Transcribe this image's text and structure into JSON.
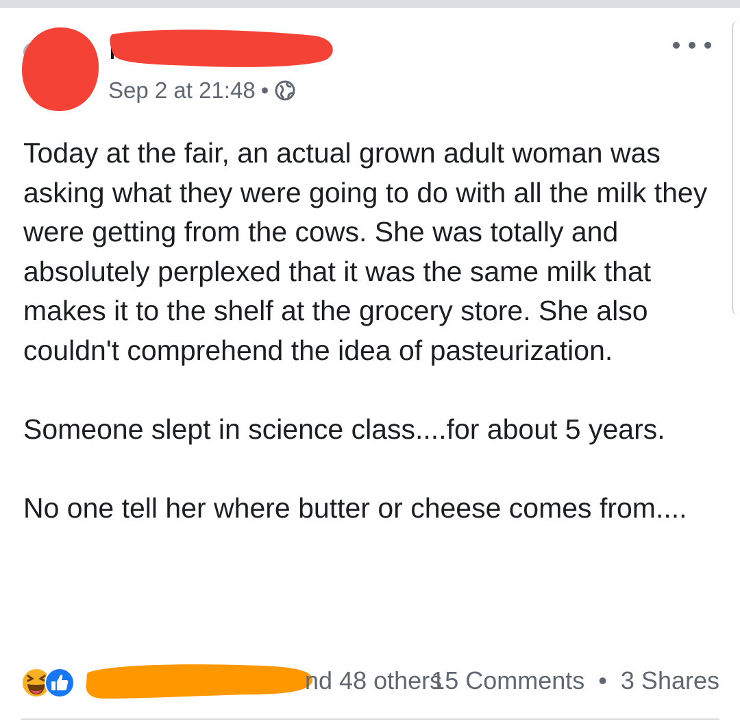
{
  "post": {
    "timestamp": "Sep 2 at 21:48",
    "meta_separator": "•",
    "privacy_icon": "globe-icon",
    "more_icon": "more-horizontal-icon",
    "paragraphs": [
      "Today at the fair, an actual grown adult woman was asking what they were going to do with all the milk they were getting from the cows. She was totally and absolutely perplexed that it was the same milk that makes it to the shelf at the grocery store. She also couldn't comprehend the idea of pasteurization.",
      "Someone slept in science class....for about 5 years.",
      "No one tell her where butter or cheese comes from...."
    ]
  },
  "footer": {
    "reaction_icons": [
      "haha-reaction-icon",
      "like-reaction-icon"
    ],
    "reactions_suffix": "nd 48 others",
    "comments": "15 Comments",
    "stats_separator": "•",
    "shares": "3 Shares"
  },
  "colors": {
    "text": "#1c1e21",
    "secondary_text": "#606770",
    "redact_red": "#f44336",
    "redact_orange": "#ff9800",
    "like_blue": "#1877f2",
    "haha_yellow": "#f7b125"
  }
}
